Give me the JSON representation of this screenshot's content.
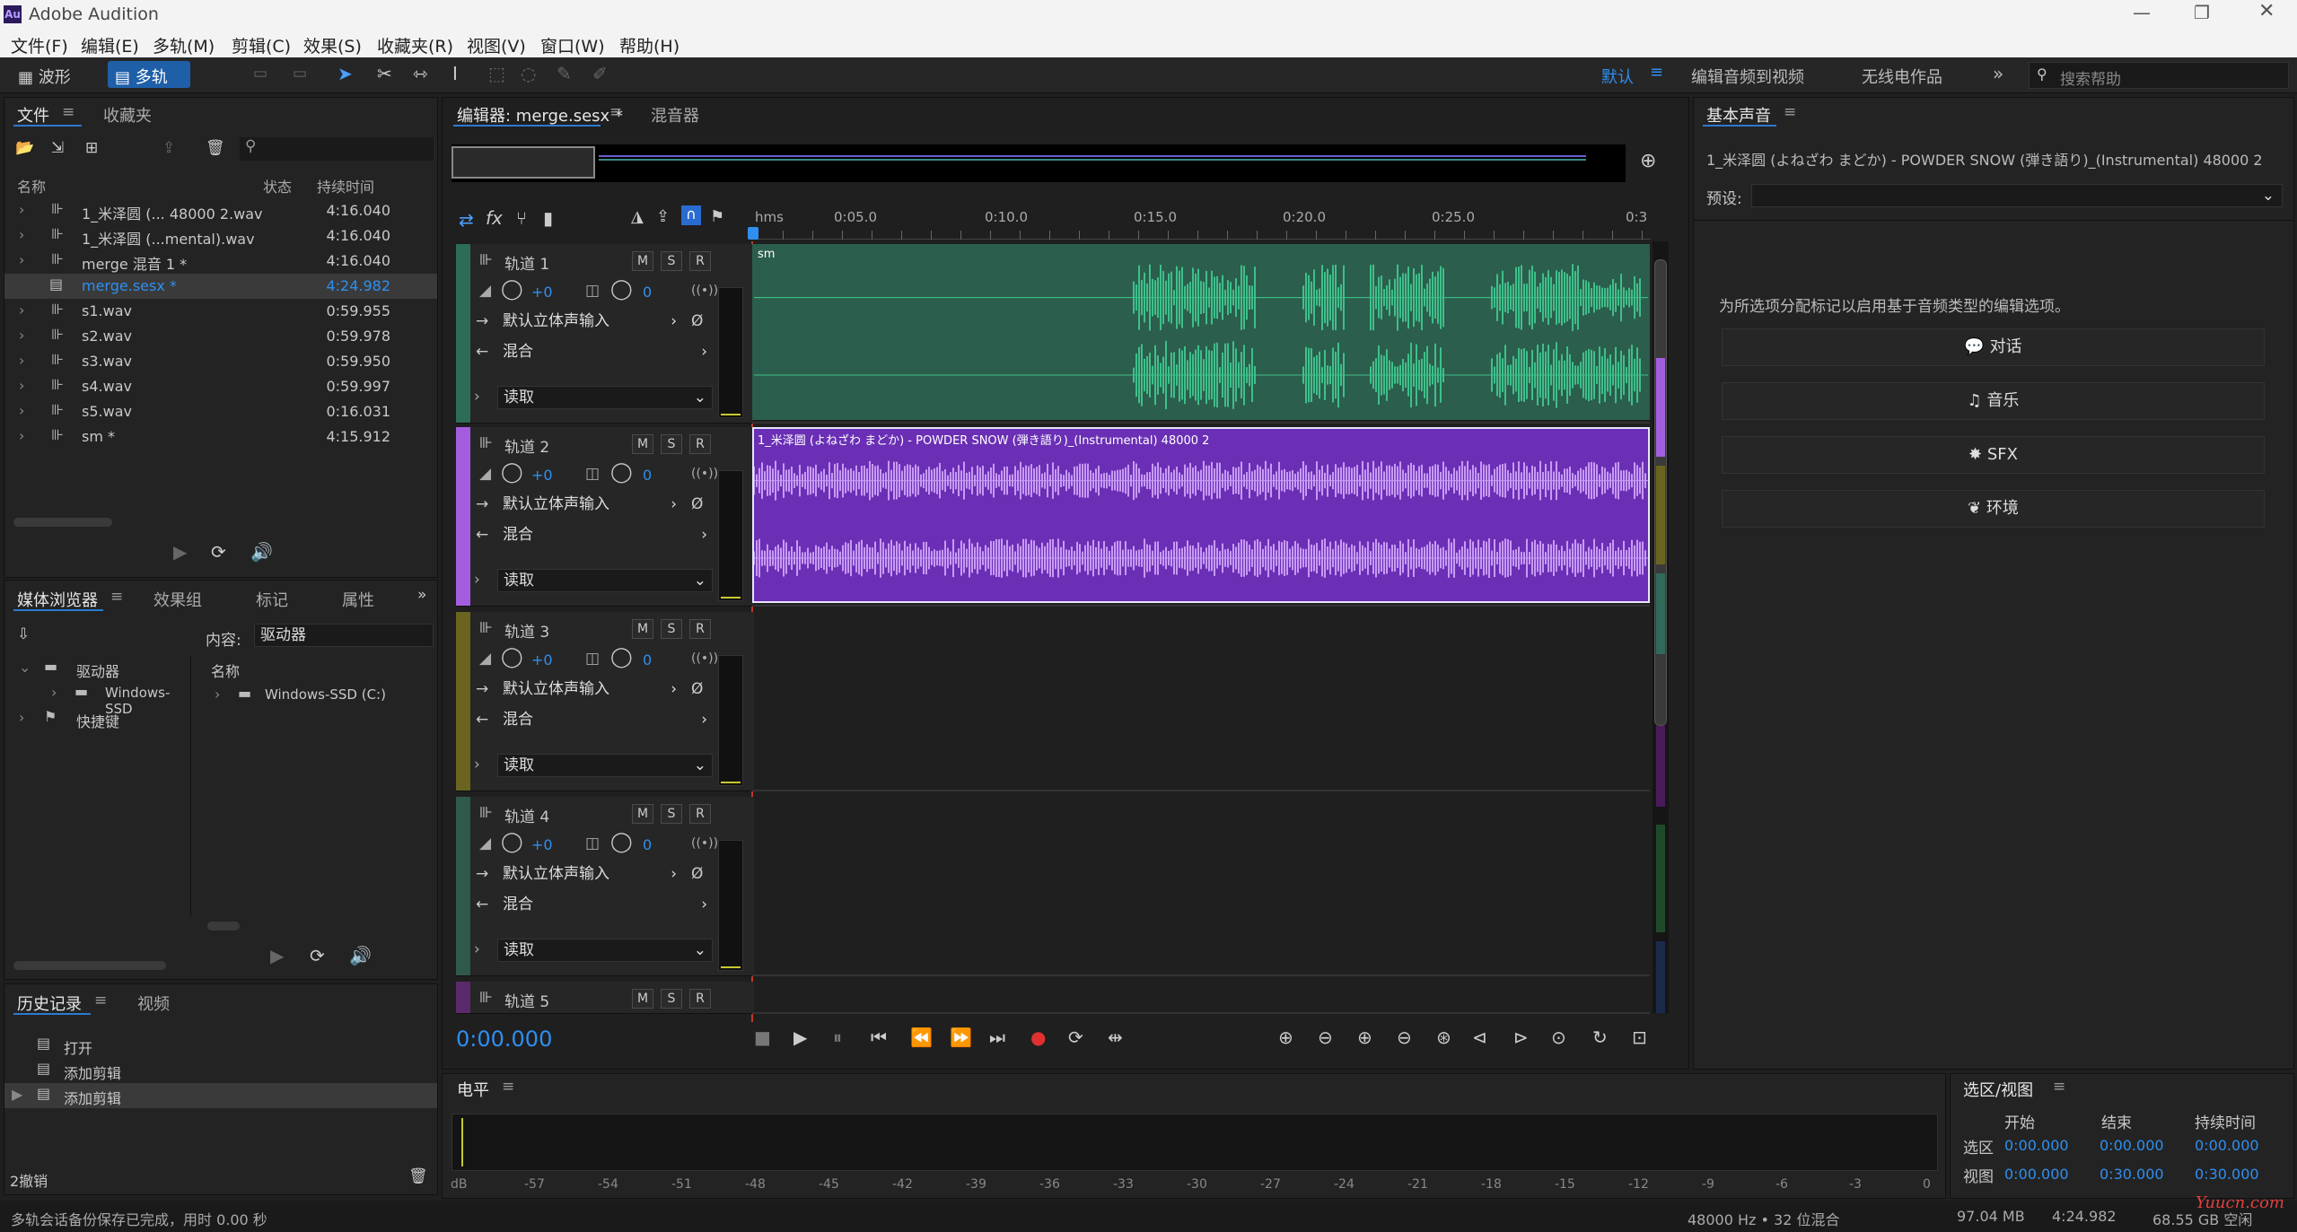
{
  "app": {
    "title": "Adobe Audition",
    "logo": "Au"
  },
  "menu": [
    "文件(F)",
    "编辑(E)",
    "多轨(M)",
    "剪辑(C)",
    "效果(S)",
    "收藏夹(R)",
    "视图(V)",
    "窗口(W)",
    "帮助(H)"
  ],
  "toolbar": {
    "waveform": "波形",
    "multitrack": "多轨",
    "workspaces": [
      "默认",
      "编辑音频到视频",
      "无线电作品"
    ],
    "search_placeholder": "搜索帮助"
  },
  "files": {
    "tabs": [
      "文件",
      "收藏夹"
    ],
    "headers": {
      "name": "名称",
      "status": "状态",
      "duration": "持续时间"
    },
    "items": [
      {
        "name": "1_米泽圆 (... 48000 2.wav",
        "dur": "4:16.040"
      },
      {
        "name": "1_米泽圆 (...mental).wav",
        "dur": "4:16.040"
      },
      {
        "name": "merge 混音 1 *",
        "dur": "4:16.040"
      },
      {
        "name": "merge.sesx *",
        "dur": "4:24.982"
      },
      {
        "name": "s1.wav",
        "dur": "0:59.955"
      },
      {
        "name": "s2.wav",
        "dur": "0:59.978"
      },
      {
        "name": "s3.wav",
        "dur": "0:59.950"
      },
      {
        "name": "s4.wav",
        "dur": "0:59.997"
      },
      {
        "name": "s5.wav",
        "dur": "0:16.031"
      },
      {
        "name": "sm *",
        "dur": "4:15.912"
      }
    ]
  },
  "media": {
    "tabs": [
      "媒体浏览器",
      "效果组",
      "标记",
      "属性"
    ],
    "content_label": "内容:",
    "content_value": "驱动器",
    "tree": [
      "驱动器",
      "Windows-SSD",
      "快捷键"
    ],
    "name_header": "名称",
    "drive": "Windows-SSD (C:)"
  },
  "history": {
    "tabs": [
      "历史记录",
      "视频"
    ],
    "items": [
      "打开",
      "添加剪辑",
      "添加剪辑"
    ],
    "undo": "2撤销"
  },
  "editor": {
    "tabs": [
      "编辑器: merge.sesx *",
      "混音器"
    ],
    "timecode": "0:00.000",
    "ruler": [
      "hms",
      "0:05.0",
      "0:10.0",
      "0:15.0",
      "0:20.0",
      "0:25.0",
      "0:3"
    ]
  },
  "tracks": [
    {
      "name": "轨道 1",
      "color": "#2d6d55",
      "vol": "+0",
      "pan": "0",
      "input": "默认立体声输入",
      "output": "混合",
      "mode": "读取",
      "clip": "sm",
      "clip_color": "#2b5e4c",
      "wave_color": "#3fbf8a"
    },
    {
      "name": "轨道 2",
      "color": "#a35ee0",
      "vol": "+0",
      "pan": "0",
      "input": "默认立体声输入",
      "output": "混合",
      "mode": "读取",
      "clip": "1_米泽圆 (よねざわ まどか) - POWDER SNOW (弾き語り)_(Instrumental) 48000 2",
      "clip_color": "#6a2fb5",
      "wave_color": "#c89af5"
    },
    {
      "name": "轨道 3",
      "color": "#6b6420",
      "vol": "+0",
      "pan": "0",
      "input": "默认立体声输入",
      "output": "混合",
      "mode": "读取"
    },
    {
      "name": "轨道 4",
      "color": "#2f5a49",
      "vol": "+0",
      "pan": "0",
      "input": "默认立体声输入",
      "output": "混合",
      "mode": "读取"
    },
    {
      "name": "轨道 5",
      "color": "#5a2a6a"
    }
  ],
  "essential": {
    "title": "基本声音",
    "clip_name": "1_米泽圆 (よねざわ まどか) - POWDER SNOW (弾き語り)_(Instrumental) 48000 2",
    "preset_label": "预设:",
    "hint": "为所选项分配标记以启用基于音频类型的编辑选项。",
    "buttons": [
      "对话",
      "音乐",
      "SFX",
      "环境"
    ]
  },
  "levels": {
    "title": "电平",
    "ticks": [
      "dB",
      "-57",
      "-54",
      "-51",
      "-48",
      "-45",
      "-42",
      "-39",
      "-36",
      "-33",
      "-30",
      "-27",
      "-24",
      "-21",
      "-18",
      "-15",
      "-12",
      "-9",
      "-6",
      "-3",
      "0"
    ]
  },
  "selection": {
    "title": "选区/视图",
    "headers": [
      "开始",
      "结束",
      "持续时间"
    ],
    "sel_label": "选区",
    "view_label": "视图",
    "sel": [
      "0:00.000",
      "0:00.000",
      "0:00.000"
    ],
    "view": [
      "0:00.000",
      "0:30.000",
      "0:30.000"
    ]
  },
  "status": {
    "left": "多轨会话备份保存已完成，用时 0.00 秒",
    "rate": "48000 Hz • 32 位混合",
    "mem": "97.04 MB",
    "dur": "4:24.982",
    "free": "68.55 GB 空闲",
    "watermark": "Yuucn.com"
  }
}
